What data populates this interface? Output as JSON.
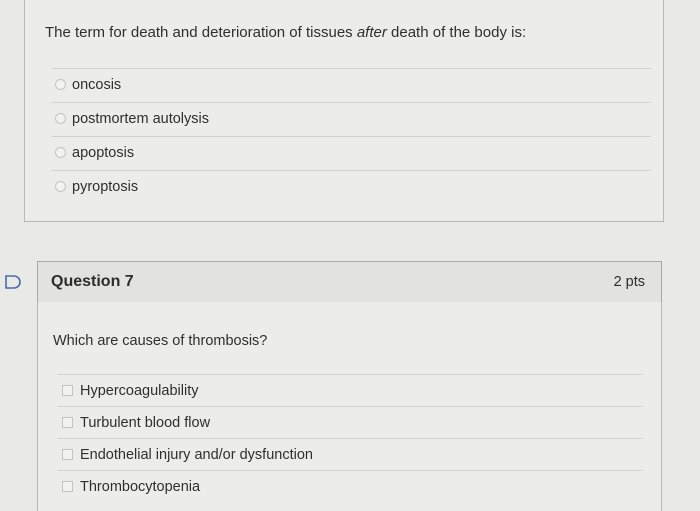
{
  "question6": {
    "text_before": "The term for death and deterioration of tissues ",
    "text_em": "after",
    "text_after": " death of the body is:",
    "options": [
      "oncosis",
      "postmortem autolysis",
      "apoptosis",
      "pyroptosis"
    ]
  },
  "question7": {
    "title": "Question 7",
    "points": "2 pts",
    "text": "Which are causes of thrombosis?",
    "options": [
      "Hypercoagulability",
      "Turbulent blood flow",
      "Endothelial injury and/or dysfunction",
      "Thrombocytopenia"
    ]
  },
  "icons": {
    "flag": "flag-icon",
    "radio": "radio-icon",
    "checkbox": "checkbox-icon"
  }
}
